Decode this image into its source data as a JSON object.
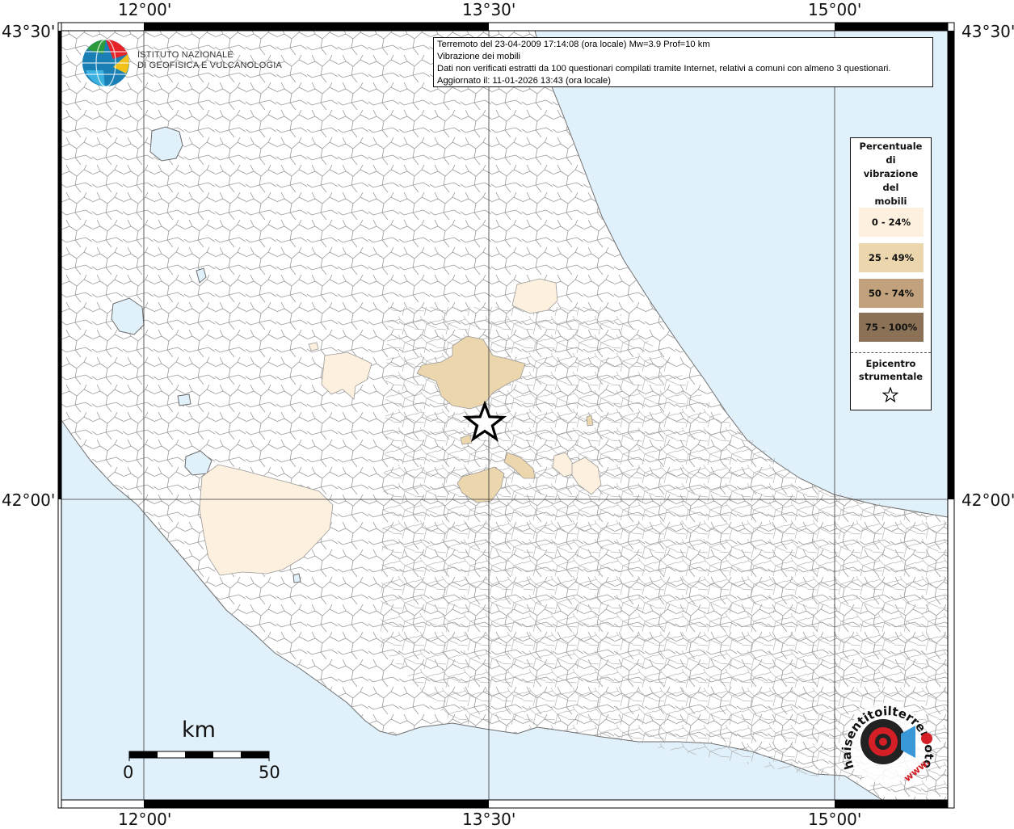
{
  "info_box": {
    "line1": "Terremoto del 23-04-2009 17:14:08 (ora locale) Mw=3.9 Prof=10 km",
    "line2": "Vibrazione dei mobili",
    "line3": "Dati non verificati estratti da 100 questionari compilati tramite Internet, relativi a comuni con almeno 3 questionari.",
    "line4": "Aggiornato il: 11-01-2026 13:43 (ora locale)"
  },
  "ingv": {
    "line1": "ISTITUTO NAZIONALE",
    "line2": "DI GEOFISICA E VULCANOLOGIA"
  },
  "coordinates": {
    "top_left": "43°30'",
    "top_right": "43°30'",
    "mid_left": "42°00'",
    "mid_right": "42°00'",
    "top_lon_1": "12°00'",
    "top_lon_2": "13°30'",
    "top_lon_3": "15°00'",
    "bottom_lon_1": "12°00'",
    "bottom_lon_2": "13°30'",
    "bottom_lon_3": "15°00'"
  },
  "legend": {
    "title_lines": [
      "Percentuale",
      "di",
      "vibrazione",
      "del",
      "mobili"
    ],
    "classes": [
      {
        "label": "0 - 24%",
        "color": "#fdf0df"
      },
      {
        "label": "25 - 49%",
        "color": "#ecd6ae"
      },
      {
        "label": "50 - 74%",
        "color": "#c1a27c"
      },
      {
        "label": "75 - 100%",
        "color": "#8b7256"
      }
    ],
    "epicenter_line1": "Epicentro",
    "epicenter_line2": "strumentale"
  },
  "scale_bar": {
    "unit": "km",
    "min_label": "0",
    "max_label": "50"
  },
  "hst_logo": {
    "text": "haisentitoilterremoto.it",
    "prefix": "www."
  },
  "colors": {
    "sea": "#e1f1fb",
    "land": "#ffffff",
    "boundary": "#8a8a8a",
    "frame": "#000000"
  }
}
